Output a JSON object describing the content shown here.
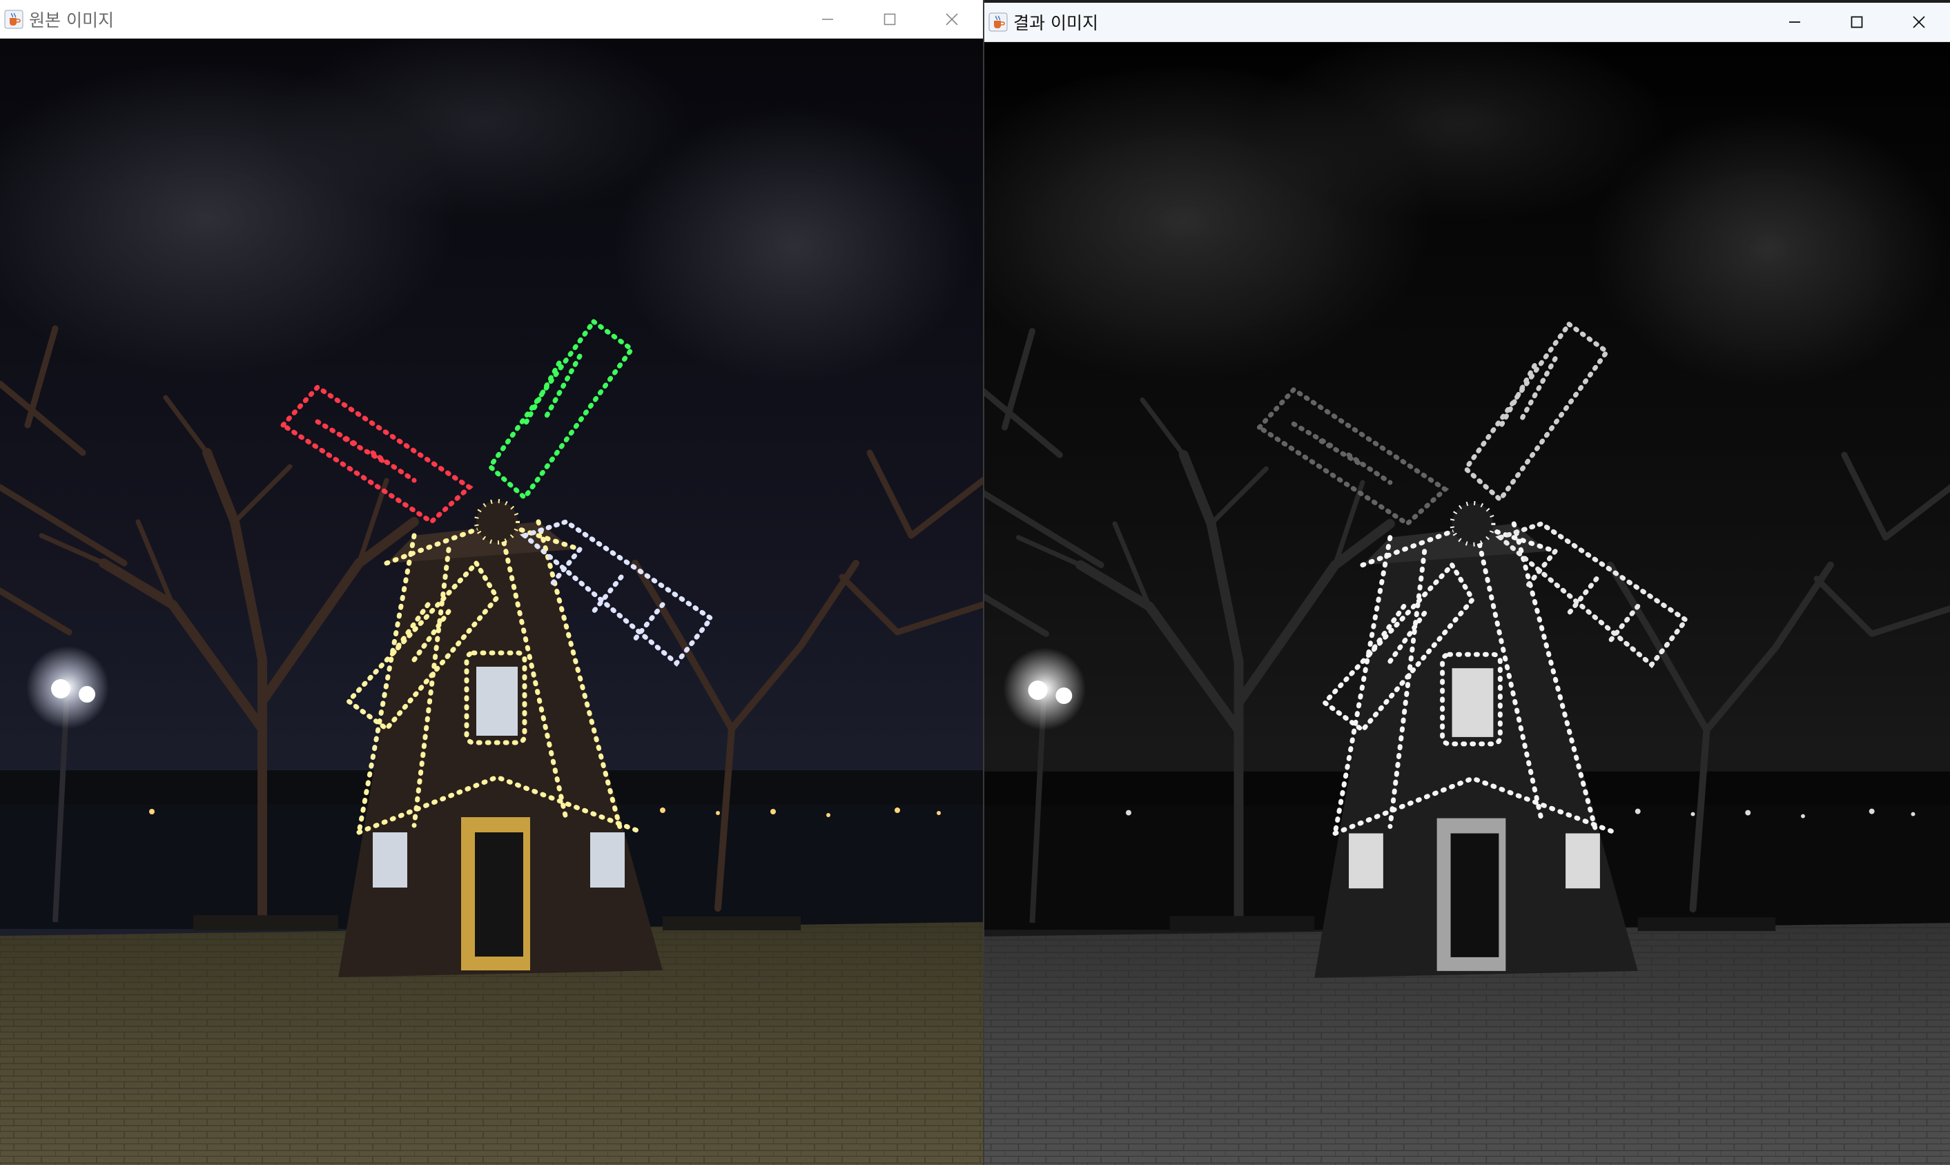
{
  "left_window": {
    "title": "원본 이미지",
    "active": false,
    "controls": [
      "minimize-icon",
      "maximize-icon",
      "close-icon"
    ]
  },
  "right_window": {
    "title": "결과 이미지",
    "active": true,
    "controls": [
      "minimize-icon",
      "maximize-icon",
      "close-icon"
    ]
  },
  "app_icon": "java-cup-icon",
  "image_content": {
    "subject": "windmill-with-led-lights",
    "colors": {
      "sky": "#0f1018",
      "blade_top_left": "#ff3a4a",
      "blade_top_right": "#3cff5a",
      "blade_right": "#5a6cff",
      "lights": "#fff3a0",
      "pavement": "#4a4432"
    }
  }
}
